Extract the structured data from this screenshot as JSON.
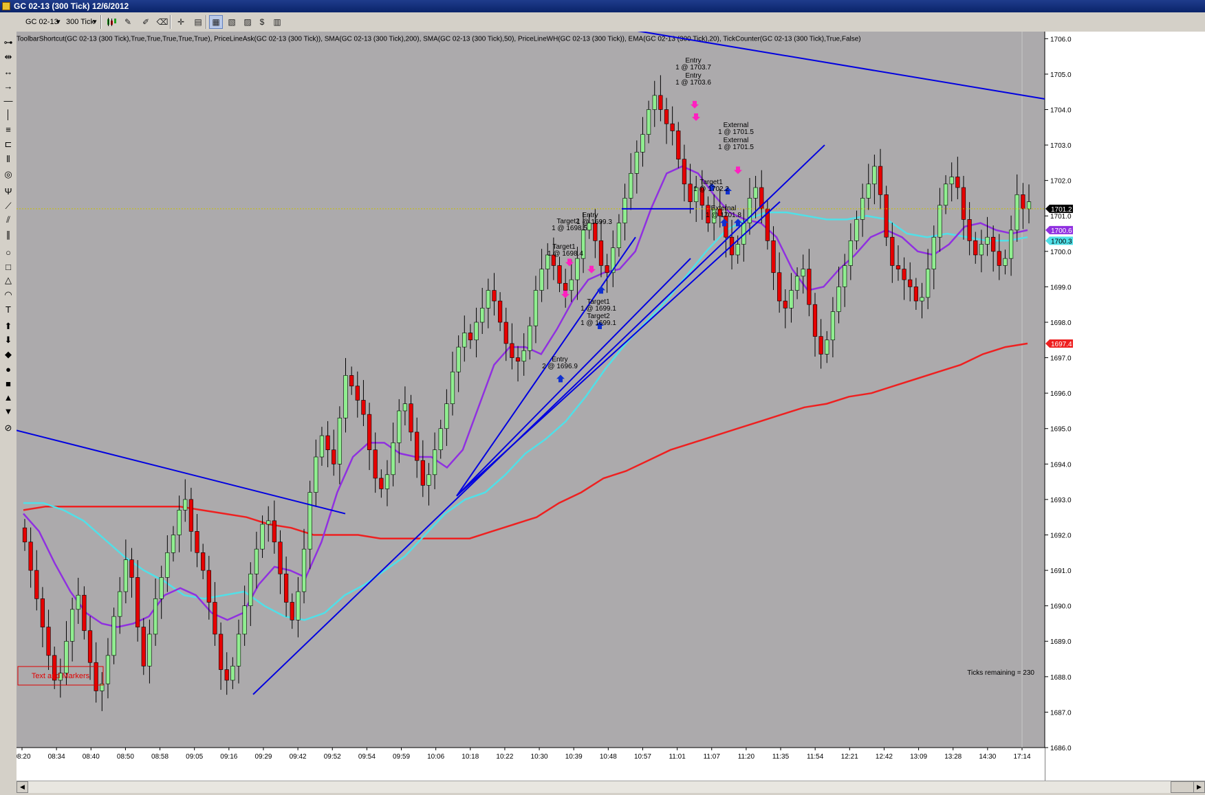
{
  "window": {
    "title": "GC 02-13 (300 Tick)  12/6/2012"
  },
  "toolbar": {
    "instrument": "GC 02-13",
    "period": "300 Tick"
  },
  "icons": {
    "instrument_dropdown": "chevron-down-icon",
    "period_dropdown": "chevron-down-icon",
    "chart_style": "candlestick-icon",
    "draw": "pencil-icon",
    "properties": "properties-icon",
    "crosshair": "crosshair-icon",
    "data_box": "data-box-icon"
  },
  "colors": {
    "chart_bg": "#acaaac",
    "up_candle": "#90ee90",
    "down_candle": "#e60000",
    "sma200": "#ee2020",
    "sma50": "#50e0e8",
    "ema20": "#9030e0",
    "trendline": "#0000e0",
    "price_line": "#c8c000",
    "axis_bg": "#ffffff"
  },
  "chart_data": {
    "type": "candlestick",
    "title": "ToolbarShortcut(GC 02-13 (300 Tick),True,True,True,True,True), PriceLineAsk(GC 02-13 (300 Tick)), SMA(GC 02-13 (300 Tick),200), SMA(GC 02-13 (300 Tick),50), PriceLineWH(GC 02-13 (300 Tick)), EMA(GC 02-13 (300 Tick),20), TickCounter(GC 02-13 (300 Tick),True,False)",
    "ylim": [
      1686.0,
      1706.2
    ],
    "y_ticks": [
      1686.0,
      1687.0,
      1688.0,
      1689.0,
      1690.0,
      1691.0,
      1692.0,
      1693.0,
      1694.0,
      1695.0,
      1696.0,
      1697.0,
      1698.0,
      1699.0,
      1700.0,
      1701.0,
      1702.0,
      1703.0,
      1704.0,
      1705.0,
      1706.0
    ],
    "x_labels": [
      "08:20",
      "08:34",
      "08:40",
      "08:50",
      "08:58",
      "09:05",
      "09:16",
      "09:29",
      "09:42",
      "09:52",
      "09:54",
      "09:59",
      "10:06",
      "10:18",
      "10:22",
      "10:30",
      "10:39",
      "10:48",
      "10:57",
      "11:01",
      "11:07",
      "11:20",
      "11:35",
      "11:54",
      "12:21",
      "12:42",
      "13:09",
      "13:28",
      "14:30",
      "17:14"
    ],
    "closes": [
      1691.8,
      1691.0,
      1690.2,
      1689.4,
      1688.6,
      1687.9,
      1688.1,
      1689.0,
      1689.9,
      1690.3,
      1689.3,
      1688.4,
      1687.6,
      1687.8,
      1688.6,
      1689.7,
      1690.4,
      1691.3,
      1690.8,
      1689.4,
      1688.3,
      1689.2,
      1690.2,
      1690.8,
      1691.5,
      1692.0,
      1692.7,
      1693.0,
      1692.1,
      1691.5,
      1691.0,
      1690.1,
      1689.2,
      1688.2,
      1687.9,
      1688.3,
      1689.2,
      1690.0,
      1690.9,
      1691.6,
      1692.3,
      1692.4,
      1691.8,
      1690.9,
      1690.1,
      1689.6,
      1690.4,
      1691.6,
      1693.2,
      1694.2,
      1694.8,
      1694.4,
      1694.0,
      1695.3,
      1696.5,
      1696.2,
      1695.8,
      1695.4,
      1694.4,
      1693.6,
      1693.3,
      1693.7,
      1694.6,
      1695.5,
      1695.7,
      1694.9,
      1694.1,
      1693.4,
      1693.7,
      1694.4,
      1695.0,
      1695.7,
      1696.6,
      1697.3,
      1697.7,
      1697.5,
      1698.0,
      1698.4,
      1698.9,
      1698.6,
      1698.0,
      1697.4,
      1697.0,
      1696.9,
      1697.2,
      1697.9,
      1698.9,
      1699.5,
      1699.9,
      1699.6,
      1699.1,
      1698.9,
      1699.2,
      1699.8,
      1700.6,
      1700.8,
      1700.3,
      1699.6,
      1699.4,
      1700.1,
      1700.8,
      1701.5,
      1702.2,
      1702.8,
      1703.3,
      1704.0,
      1704.4,
      1704.0,
      1703.6,
      1703.4,
      1702.6,
      1701.9,
      1701.4,
      1701.8,
      1701.3,
      1700.8,
      1701.2,
      1701.0,
      1700.4,
      1699.9,
      1700.2,
      1700.8,
      1701.5,
      1701.8,
      1701.2,
      1700.3,
      1699.4,
      1698.6,
      1698.4,
      1698.9,
      1699.3,
      1699.5,
      1698.5,
      1697.6,
      1697.1,
      1697.5,
      1698.3,
      1699.0,
      1699.6,
      1700.3,
      1700.9,
      1701.5,
      1701.9,
      1702.4,
      1701.6,
      1700.4,
      1699.6,
      1699.5,
      1699.2,
      1699.0,
      1698.6,
      1698.7,
      1699.5,
      1700.4,
      1701.3,
      1701.9,
      1702.1,
      1701.8,
      1700.9,
      1700.3,
      1699.9,
      1700.2,
      1700.4,
      1700.0,
      1699.6,
      1699.8,
      1700.6,
      1701.6,
      1701.2,
      1701.4
    ],
    "sma200": [
      1692.7,
      1692.8,
      1692.8,
      1692.8,
      1692.8,
      1692.8,
      1692.8,
      1692.8,
      1692.7,
      1692.6,
      1692.5,
      1692.3,
      1692.2,
      1692.0,
      1692.0,
      1692.0,
      1691.9,
      1691.9,
      1691.9,
      1691.9,
      1691.9,
      1692.1,
      1692.3,
      1692.5,
      1692.9,
      1693.2,
      1693.6,
      1693.8,
      1694.1,
      1694.4,
      1694.6,
      1694.8,
      1695.0,
      1695.2,
      1695.4,
      1695.6,
      1695.7,
      1695.9,
      1696.0,
      1696.2,
      1696.4,
      1696.6,
      1696.8,
      1697.1,
      1697.3,
      1697.4
    ],
    "sma50": [
      1692.9,
      1692.9,
      1692.7,
      1692.4,
      1691.9,
      1691.4,
      1691.0,
      1690.7,
      1690.3,
      1690.2,
      1690.3,
      1690.4,
      1690.0,
      1689.7,
      1689.6,
      1689.8,
      1690.3,
      1690.6,
      1691.0,
      1691.4,
      1692.0,
      1692.6,
      1693.0,
      1693.2,
      1693.7,
      1694.3,
      1694.7,
      1695.2,
      1695.9,
      1696.7,
      1697.4,
      1698.0,
      1698.6,
      1699.3,
      1700.0,
      1700.6,
      1700.9,
      1701.1,
      1701.1,
      1701.0,
      1700.9,
      1700.9,
      1701.0,
      1700.9,
      1700.5,
      1700.4,
      1700.5,
      1700.4,
      1700.3,
      1700.3,
      1700.4
    ],
    "ema20": [
      1692.6,
      1692.1,
      1691.2,
      1690.4,
      1689.8,
      1689.5,
      1689.4,
      1689.5,
      1689.7,
      1690.3,
      1690.5,
      1690.3,
      1689.8,
      1689.6,
      1689.8,
      1690.6,
      1691.1,
      1691.0,
      1690.8,
      1691.8,
      1693.2,
      1694.2,
      1694.6,
      1694.6,
      1694.3,
      1694.2,
      1694.2,
      1693.9,
      1694.4,
      1695.6,
      1696.8,
      1697.3,
      1697.3,
      1697.1,
      1697.8,
      1698.6,
      1699.2,
      1699.4,
      1699.5,
      1700.0,
      1701.2,
      1702.2,
      1702.4,
      1702.2,
      1701.6,
      1701.1,
      1700.9,
      1700.8,
      1700.4,
      1699.5,
      1698.9,
      1699.0,
      1699.5,
      1699.9,
      1700.4,
      1700.6,
      1700.4,
      1700.0,
      1699.9,
      1700.2,
      1700.7,
      1700.8,
      1700.6,
      1700.5,
      1700.6
    ],
    "current_prices": {
      "last": "1701.2",
      "ema20": "1700.6",
      "sma50": "1700.3",
      "sma200": "1697.4"
    },
    "annotations": [
      {
        "text": "Entry",
        "x": 1008,
        "y": 87
      },
      {
        "text": "1 @ 1703.7",
        "x": 1008,
        "y": 97
      },
      {
        "text": "Entry",
        "x": 1008,
        "y": 109
      },
      {
        "text": "1 @ 1703.6",
        "x": 1008,
        "y": 119
      },
      {
        "text": "External",
        "x": 1070,
        "y": 181
      },
      {
        "text": "1 @ 1701.5",
        "x": 1070,
        "y": 191
      },
      {
        "text": "External",
        "x": 1070,
        "y": 203
      },
      {
        "text": "1 @ 1701.5",
        "x": 1070,
        "y": 213
      },
      {
        "text": "Target1",
        "x": 1034,
        "y": 264
      },
      {
        "text": "1 @ 1702.2",
        "x": 1034,
        "y": 274
      },
      {
        "text": "External",
        "x": 1052,
        "y": 302
      },
      {
        "text": "1 @ 1701.8",
        "x": 1052,
        "y": 312
      },
      {
        "text": "Entry",
        "x": 858,
        "y": 312
      },
      {
        "text": "Target2",
        "x": 826,
        "y": 321
      },
      {
        "text": "1 @ 1699.3",
        "x": 864,
        "y": 322
      },
      {
        "text": "1 @ 1698.5",
        "x": 828,
        "y": 331
      },
      {
        "text": "Target1",
        "x": 820,
        "y": 358
      },
      {
        "text": "1 @ 1698.4",
        "x": 822,
        "y": 368
      },
      {
        "text": "Target1",
        "x": 870,
        "y": 438
      },
      {
        "text": "1 @ 1699.1",
        "x": 870,
        "y": 448
      },
      {
        "text": "Target2",
        "x": 870,
        "y": 459
      },
      {
        "text": "1 @ 1699.1",
        "x": 870,
        "y": 469
      },
      {
        "text": "Entry",
        "x": 814,
        "y": 522
      },
      {
        "text": "2 @ 1696.9",
        "x": 814,
        "y": 532
      }
    ],
    "markers": {
      "sell_arrows": [
        [
          1010,
          1704.05
        ],
        [
          1012,
          1703.7
        ],
        [
          1073,
          1702.2
        ],
        [
          828,
          1699.6
        ],
        [
          860,
          1699.4
        ],
        [
          822,
          1698.7
        ]
      ],
      "buy_arrows": [
        [
          815,
          1696.5
        ],
        [
          872,
          1698.0
        ],
        [
          874,
          1699.0
        ],
        [
          1035,
          1701.9
        ],
        [
          1053,
          1700.9
        ],
        [
          1073,
          1700.9
        ],
        [
          1058,
          1701.8
        ]
      ]
    },
    "ticks_remaining": "Ticks remaining = 230",
    "legend_box": "Text and Markers"
  }
}
